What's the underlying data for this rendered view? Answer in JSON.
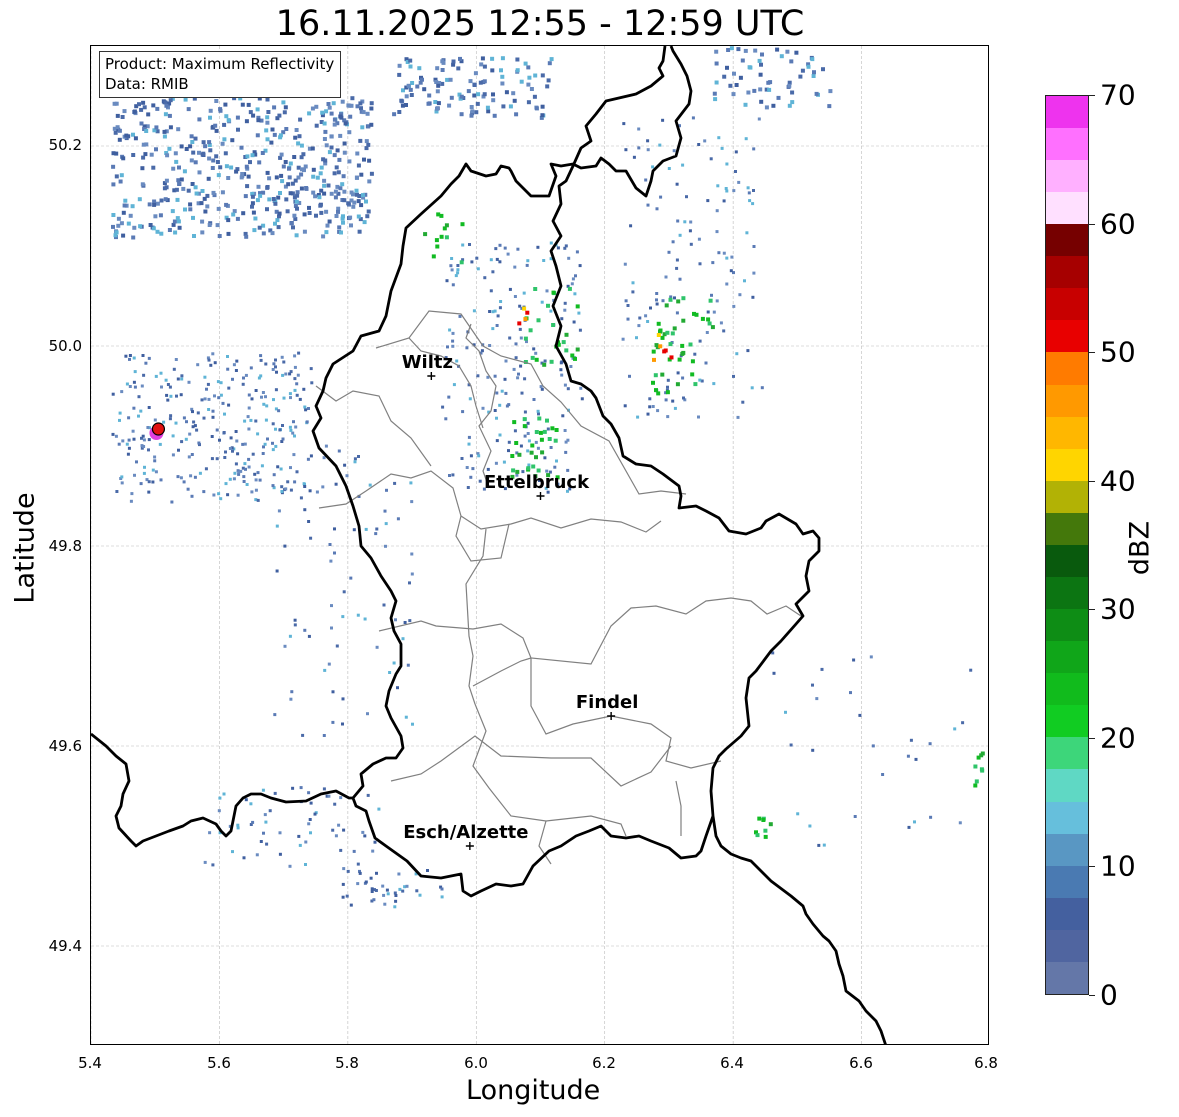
{
  "title": "16.11.2025 12:55 - 12:59 UTC",
  "info_box": {
    "line1": "Product: Maximum Reflectivity",
    "line2": "Data: RMIB"
  },
  "x_axis": {
    "label": "Longitude",
    "ticks": [
      "5.4",
      "5.6",
      "5.8",
      "6.0",
      "6.2",
      "6.4",
      "6.6",
      "6.8"
    ],
    "range": [
      5.4,
      6.8
    ]
  },
  "y_axis": {
    "label": "Latitude",
    "ticks": [
      "49.4",
      "49.6",
      "49.8",
      "50.0",
      "50.2"
    ],
    "range": [
      49.3,
      50.3
    ]
  },
  "colorbar": {
    "label": "dBZ",
    "ticks": [
      "0",
      "10",
      "20",
      "30",
      "40",
      "50",
      "60",
      "70"
    ],
    "colors": [
      "#6477a8",
      "#5065a0",
      "#44609f",
      "#4a7ab2",
      "#5997c3",
      "#66bfdc",
      "#5fd8c4",
      "#3dd67a",
      "#11cc22",
      "#11bb1c",
      "#10a619",
      "#0e8d15",
      "#0c7512",
      "#095a0d",
      "#44780b",
      "#b2b205",
      "#ffd500",
      "#ffb700",
      "#ff9900",
      "#ff7b00",
      "#e80000",
      "#c80000",
      "#a60000",
      "#760000",
      "#ffe0ff",
      "#ffb0ff",
      "#ff70ff",
      "#ee33ee"
    ]
  },
  "cities": [
    {
      "name": "Wiltz",
      "lon": 5.93,
      "lat": 49.97
    },
    {
      "name": "Ettelbruck",
      "lon": 6.1,
      "lat": 49.85
    },
    {
      "name": "Findel",
      "lon": 6.21,
      "lat": 49.63
    },
    {
      "name": "Esch/Alzette",
      "lon": 5.99,
      "lat": 49.5
    }
  ],
  "radar_marker": {
    "lon": 5.505,
    "lat": 49.917
  }
}
